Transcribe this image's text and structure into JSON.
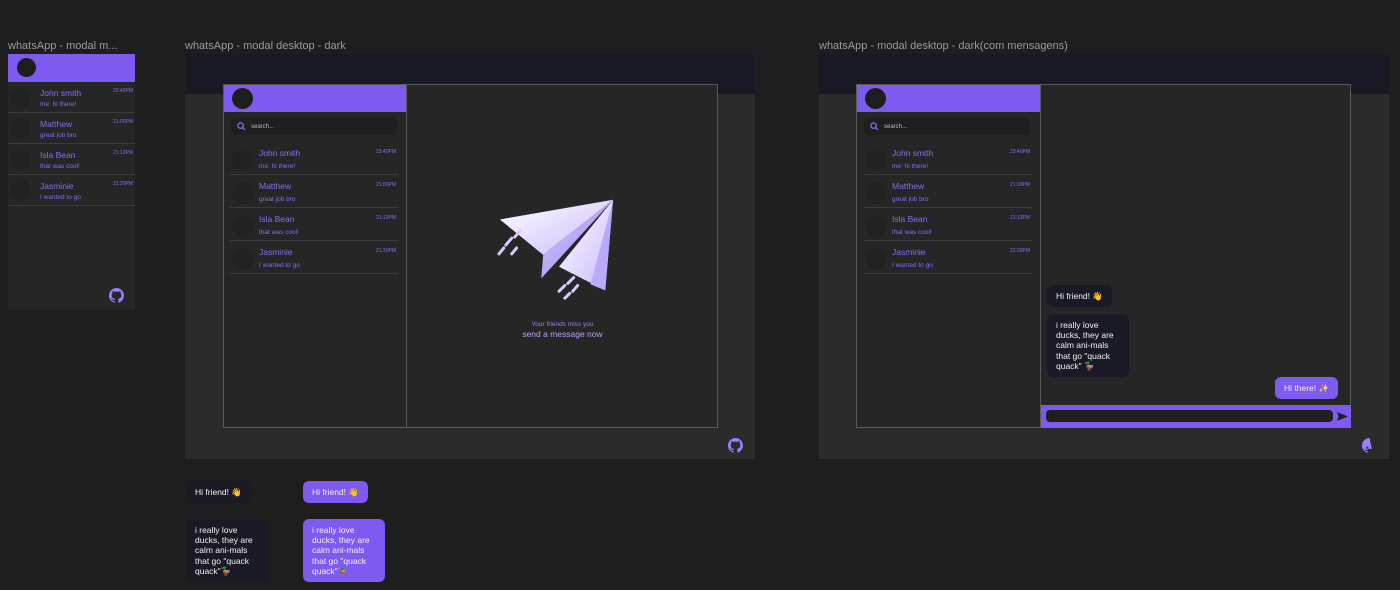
{
  "frames": {
    "mobile": {
      "title": "whatsApp - modal m..."
    },
    "desktop": {
      "title": "whatsApp - modal desktop - dark"
    },
    "desktop_messages": {
      "title": "whatsApp - modal desktop - dark(com mensagens)"
    }
  },
  "search": {
    "placeholder": "search..."
  },
  "chats": [
    {
      "name": "John smith",
      "message": "me: hi there!",
      "time": "23:40PM"
    },
    {
      "name": "Matthew",
      "message": "great job bro",
      "time": "21:00PM"
    },
    {
      "name": "Isla Bean",
      "message": "that was cool!",
      "time": "21:13PM"
    },
    {
      "name": "Jasminie",
      "message": "I wanted to go",
      "time": "21:30PM"
    }
  ],
  "mobile_chats": [
    {
      "name": "John smith",
      "message": "me: hi there!",
      "time": "23:40PM"
    },
    {
      "name": "Matthew",
      "message": "great job bro",
      "time": "21:00PM"
    },
    {
      "name": "Isla Bean",
      "message": "that was cool!",
      "time": "21:13PM"
    },
    {
      "name": "Jasminie",
      "message": "I wanted to go",
      "time": "21:30PM"
    }
  ],
  "empty_state": {
    "subtitle": "Your friends miss you",
    "cta": "send a message now"
  },
  "conversation": {
    "received_1": "Hi friend! 👋",
    "received_2": "i really love ducks, they are calm ani-mals that go \"quack quack\" 🦆",
    "sent_1": "Hi there! ✨"
  },
  "components": {
    "dark_hi": "Hi friend! 👋",
    "purple_hi": "Hi friend! 👋",
    "dark_ducks": "i really love ducks, they are calm ani-mals that go \"quack quack\"🦆",
    "purple_ducks": "i really love ducks, they are calm ani-mals that go \"quack quack\"🦆"
  },
  "icons": {
    "github": "github-icon",
    "search": "search-icon",
    "send": "send-icon",
    "paper_plane": "paper-plane-illustration"
  },
  "colors": {
    "accent": "#7f5af0",
    "background": "#1e1e1e",
    "frame": "#2b2b2b",
    "window": "#262626"
  }
}
